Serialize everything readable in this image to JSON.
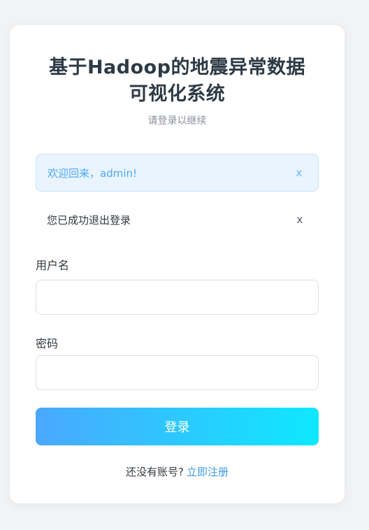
{
  "login": {
    "title_line1": "基于Hadoop的地震异常数据",
    "title_line2": "可视化系统",
    "subtitle": "请登录以继续"
  },
  "alerts": [
    {
      "message": "欢迎回来，admin!",
      "close": "x",
      "type": "info"
    },
    {
      "message": "您已成功退出登录",
      "close": "x",
      "type": "plain"
    }
  ],
  "form": {
    "username_label": "用户名",
    "username_value": "",
    "password_label": "密码",
    "password_value": "",
    "submit_label": "登录"
  },
  "footer": {
    "prompt": "还没有账号?",
    "register_link": "立即注册"
  },
  "colors": {
    "accent": "#4aa8ff",
    "accent_end": "#0ee8ff",
    "info_text": "#4ea8f5",
    "link": "#3d9be8"
  }
}
